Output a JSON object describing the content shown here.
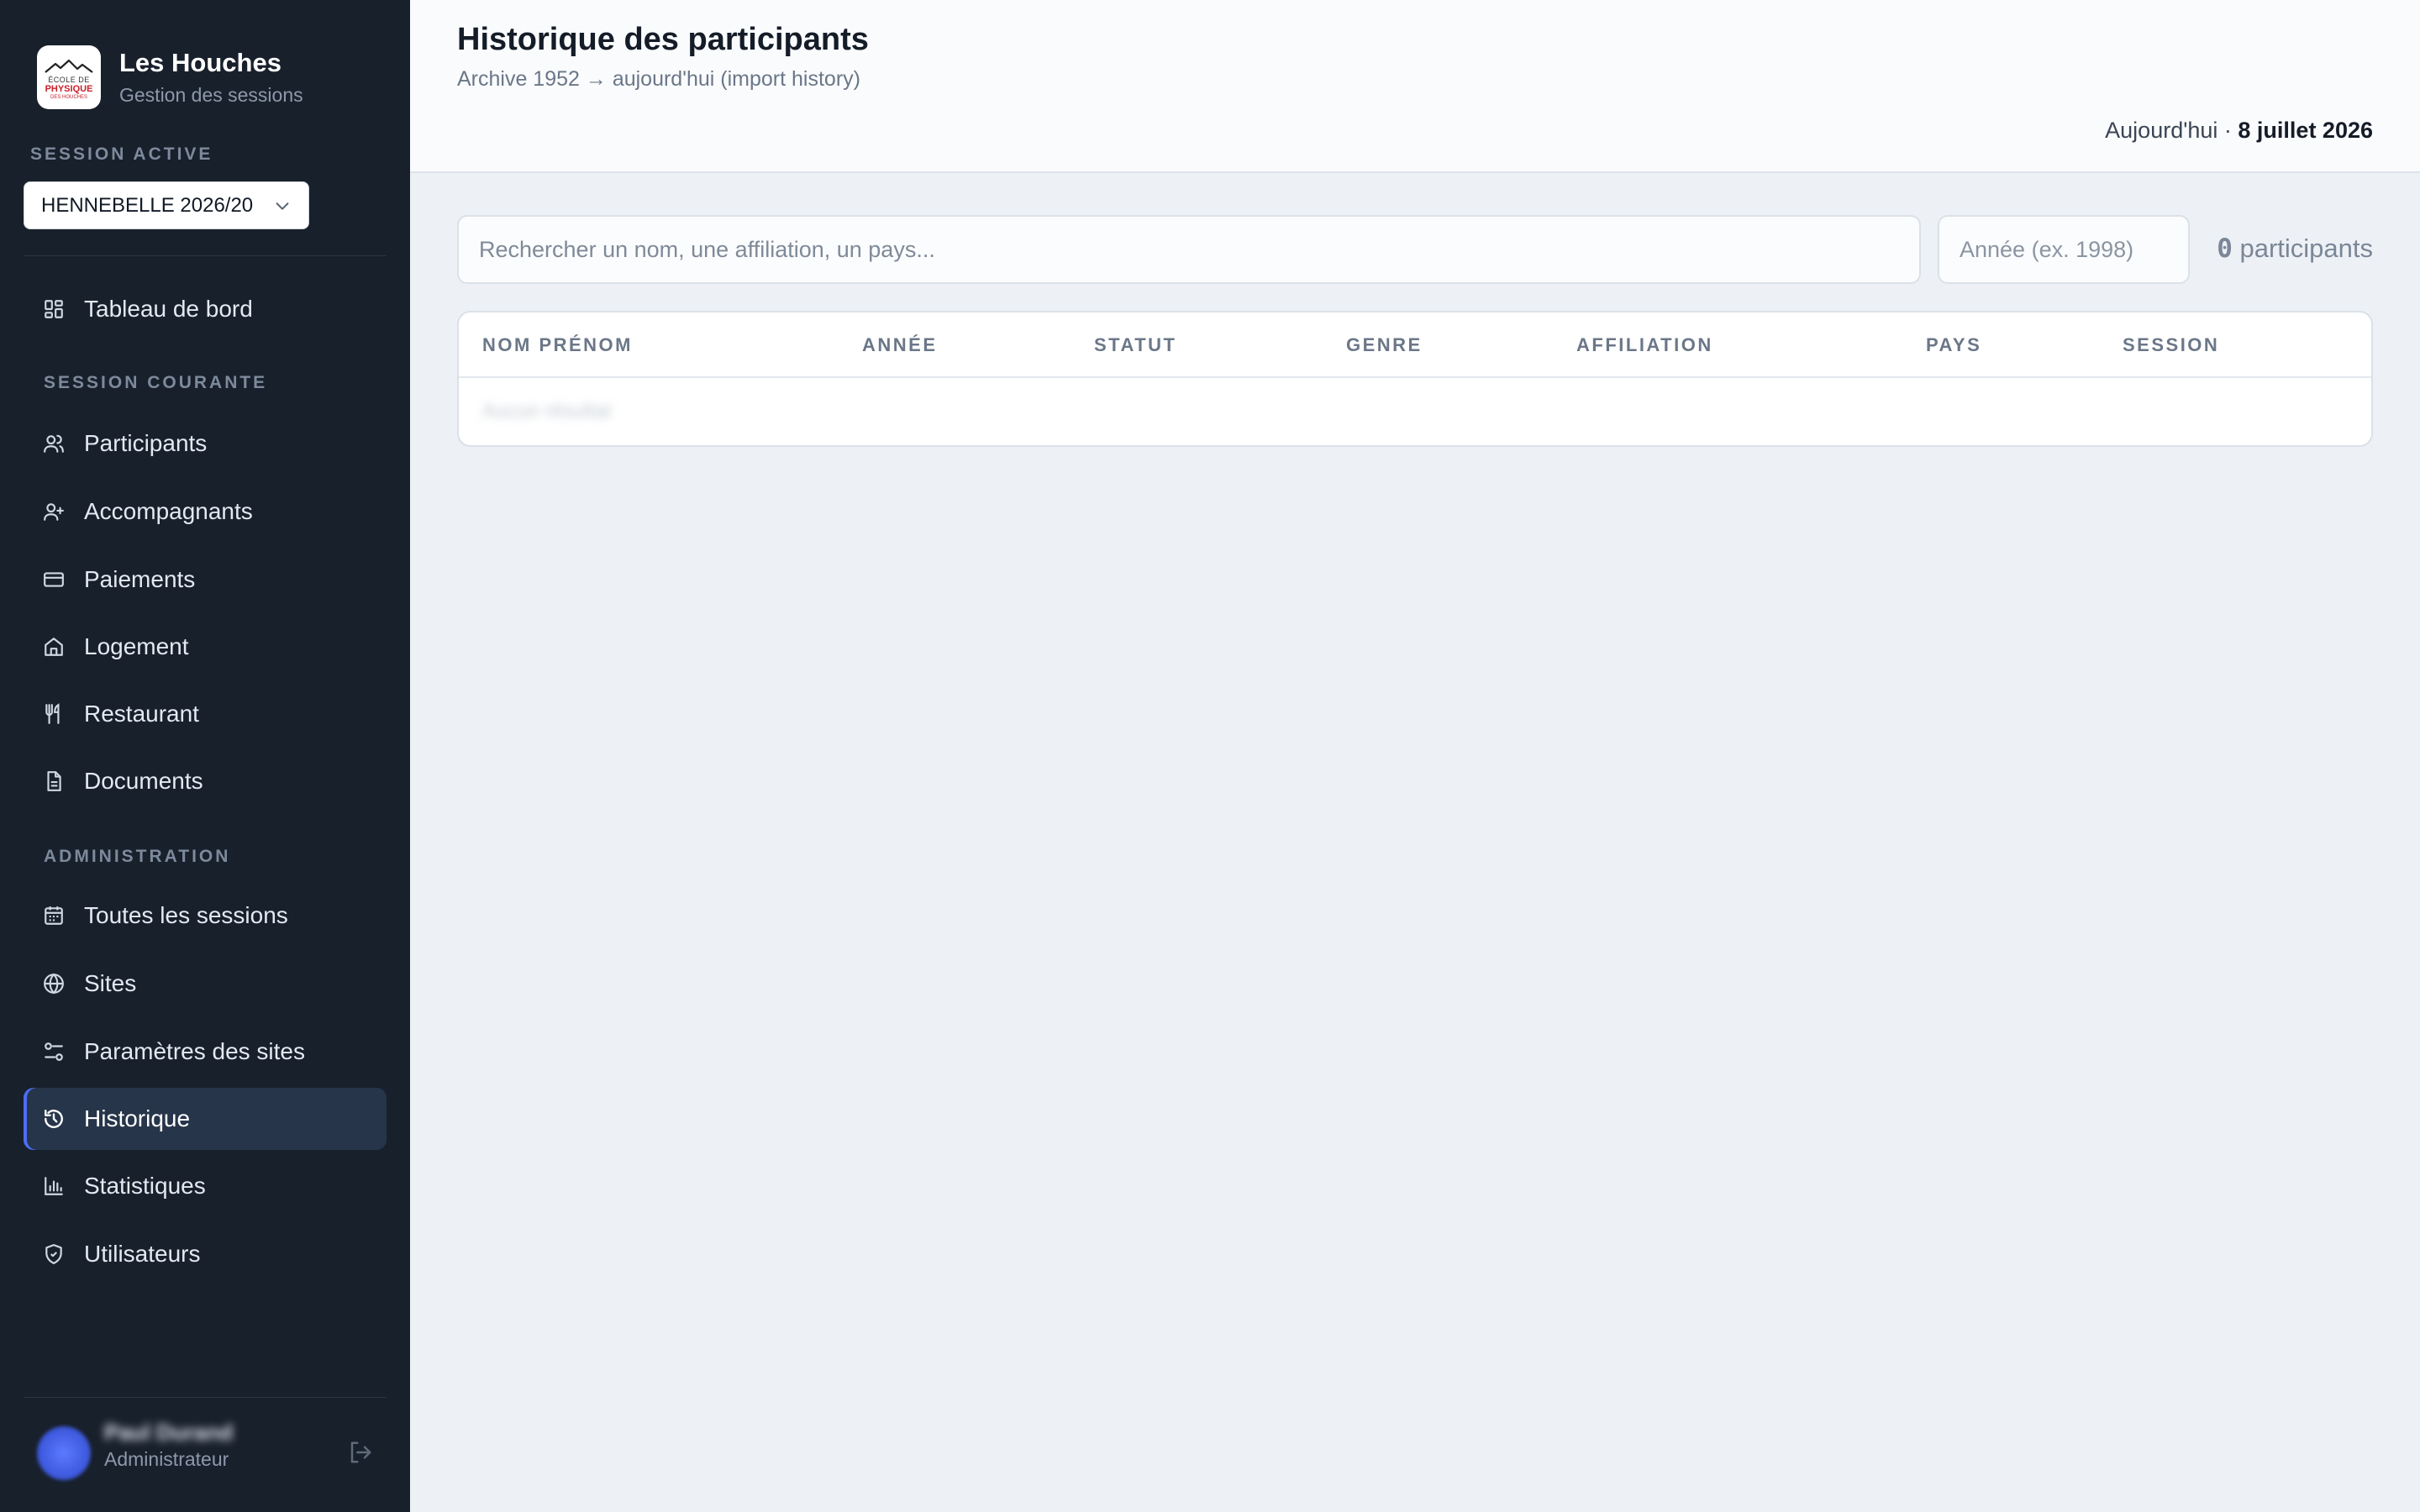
{
  "app": {
    "title": "Les Houches",
    "subtitle": "Gestion des sessions",
    "logo_lines": [
      "ÉCOLE DE",
      "PHYSIQUE",
      "DES HOUCHES"
    ]
  },
  "sidebar": {
    "session_label": "SESSION ACTIVE",
    "session_value": "HENNEBELLE 2026/20",
    "dashboard": {
      "label": "Tableau de bord",
      "icon": "dashboard-grid-icon"
    },
    "section_current": "SESSION COURANTE",
    "current_items": [
      {
        "label": "Participants",
        "icon": "users-icon"
      },
      {
        "label": "Accompagnants",
        "icon": "user-plus-icon"
      },
      {
        "label": "Paiements",
        "icon": "credit-card-icon"
      },
      {
        "label": "Logement",
        "icon": "home-icon"
      },
      {
        "label": "Restaurant",
        "icon": "utensils-icon"
      },
      {
        "label": "Documents",
        "icon": "document-icon"
      }
    ],
    "section_admin": "ADMINISTRATION",
    "admin_items": [
      {
        "label": "Toutes les sessions",
        "icon": "calendar-icon"
      },
      {
        "label": "Sites",
        "icon": "globe-icon"
      },
      {
        "label": "Paramètres des sites",
        "icon": "sliders-icon"
      },
      {
        "label": "Historique",
        "icon": "history-icon",
        "active": true
      },
      {
        "label": "Statistiques",
        "icon": "bar-chart-icon"
      },
      {
        "label": "Utilisateurs",
        "icon": "shield-icon"
      }
    ],
    "user": {
      "name": "Paul Durand",
      "role": "Administrateur"
    }
  },
  "header": {
    "title": "Historique des participants",
    "subtitle": "Archive 1952 → aujourd'hui (import history)",
    "today_prefix": "Aujourd'hui · ",
    "today_date": "8 juillet 2026"
  },
  "filters": {
    "search_placeholder": "Rechercher un nom, une affiliation, un pays...",
    "year_placeholder": "Année (ex. 1998)",
    "count_value": "0",
    "count_suffix": " participants"
  },
  "table": {
    "columns": [
      "NOM PRÉNOM",
      "ANNÉE",
      "STATUT",
      "GENRE",
      "AFFILIATION",
      "PAYS",
      "SESSION"
    ],
    "placeholder_row": "Aucun résultat"
  },
  "colors": {
    "sidebar_bg": "#18202c",
    "active_accent": "#4c6ef5",
    "main_bg": "#edf1f5",
    "logo_red": "#c8202a"
  }
}
